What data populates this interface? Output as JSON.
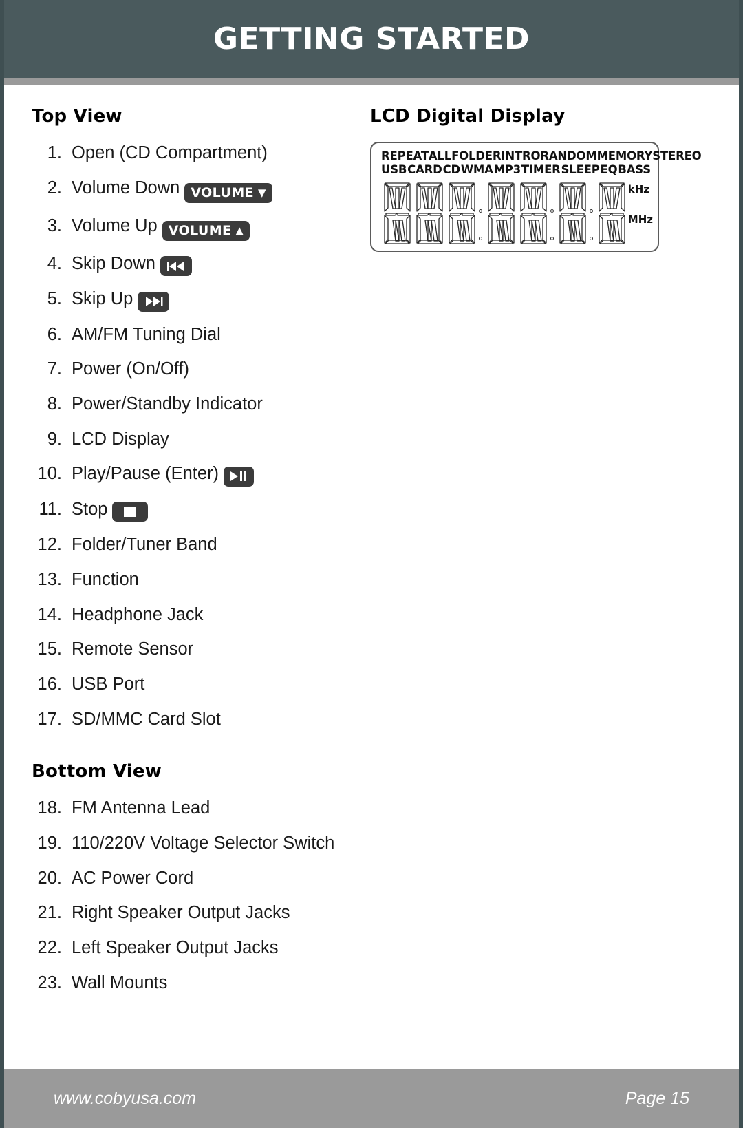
{
  "header": {
    "title": "GETTING STARTED"
  },
  "sections": {
    "top_view": "Top View",
    "lcd_display": "LCD Digital Display",
    "bottom_view": "Bottom View"
  },
  "top_view_items": [
    {
      "num": "1.",
      "label": "Open (CD Compartment)",
      "badge": null
    },
    {
      "num": "2.",
      "label": "Volume Down",
      "badge": "volume-down"
    },
    {
      "num": "3.",
      "label": "Volume Up",
      "badge": "volume-up"
    },
    {
      "num": "4.",
      "label": "Skip Down",
      "badge": "skip-back"
    },
    {
      "num": "5.",
      "label": "Skip Up",
      "badge": "skip-forward"
    },
    {
      "num": "6.",
      "label": "AM/FM Tuning Dial",
      "badge": null
    },
    {
      "num": "7.",
      "label": "Power (On/Off)",
      "badge": null
    },
    {
      "num": "8.",
      "label": "Power/Standby Indicator",
      "badge": null
    },
    {
      "num": "9.",
      "label": "LCD Display",
      "badge": null
    },
    {
      "num": "10.",
      "label": "Play/Pause (Enter)",
      "badge": "play-pause"
    },
    {
      "num": "11.",
      "label": "Stop",
      "badge": "stop"
    },
    {
      "num": "12.",
      "label": "Folder/Tuner Band",
      "badge": null
    },
    {
      "num": "13.",
      "label": "Function",
      "badge": null
    },
    {
      "num": "14.",
      "label": "Headphone Jack",
      "badge": null
    },
    {
      "num": "15.",
      "label": "Remote Sensor",
      "badge": null
    },
    {
      "num": "16.",
      "label": "USB Port",
      "badge": null
    },
    {
      "num": "17.",
      "label": "SD/MMC Card Slot",
      "badge": null
    }
  ],
  "bottom_view_items": [
    {
      "num": "18.",
      "label": "FM Antenna Lead",
      "badge": null
    },
    {
      "num": "19.",
      "label": "110/220V Voltage Selector Switch",
      "badge": null
    },
    {
      "num": "20.",
      "label": "AC Power Cord",
      "badge": null
    },
    {
      "num": "21.",
      "label": "Right Speaker Output Jacks",
      "badge": null
    },
    {
      "num": "22.",
      "label": "Left Speaker Output Jacks",
      "badge": null
    },
    {
      "num": "23.",
      "label": "Wall Mounts",
      "badge": null
    }
  ],
  "badge_labels": {
    "volume_text": "VOLUME",
    "volume_down_arrow": "▼",
    "volume_up_arrow": "▲"
  },
  "lcd": {
    "indicators_row1": [
      "REPEAT",
      "ALL",
      "FOLDER",
      "INTRO",
      "RANDOM",
      "MEMORY",
      "STEREO"
    ],
    "indicators_row2": [
      "USB",
      "CARD",
      "CD",
      "WMA",
      "MP3",
      "TIMER",
      "SLEEP",
      "EQ",
      "BASS"
    ],
    "digit_count": 7,
    "units": [
      "kHz",
      "MHz"
    ]
  },
  "footer": {
    "website": "www.cobyusa.com",
    "page": "Page 15"
  },
  "colors": {
    "header_bg": "#4a5a5d",
    "header_rule": "#9a9a9a",
    "footer_bg": "#9a9a9a",
    "badge_bg": "#3b3b3b",
    "text": "#1a1a1a"
  }
}
